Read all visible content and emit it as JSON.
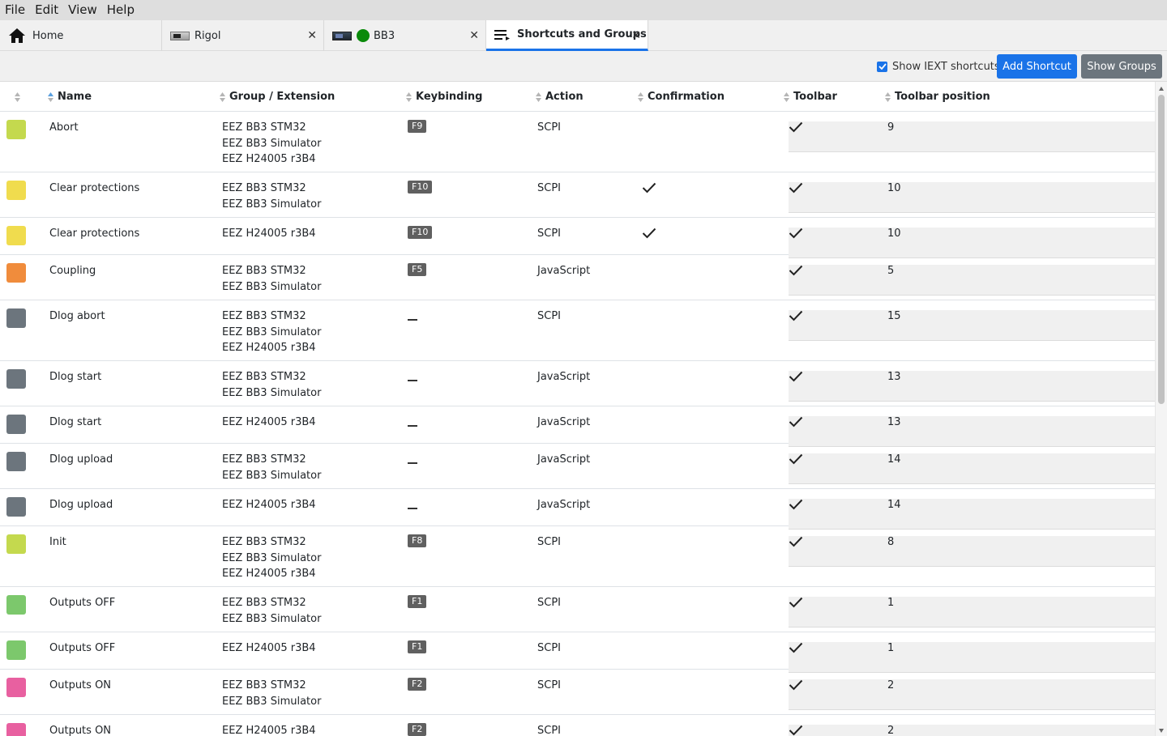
{
  "menu": [
    "File",
    "Edit",
    "View",
    "Help"
  ],
  "tabs": [
    {
      "label": "Home",
      "icon": "home-icon",
      "closable": false,
      "active": false
    },
    {
      "label": "Rigol",
      "icon": "instrument-thumbnail-icon",
      "closable": true,
      "active": false
    },
    {
      "label": "BB3",
      "icon": "instrument-thumbnail-icon",
      "status": "connected",
      "closable": true,
      "active": false
    },
    {
      "label": "Shortcuts and Groups",
      "icon": "playlist-icon",
      "closable": true,
      "active": true
    }
  ],
  "toolbar": {
    "show_iext_label": "Show IEXT shortcuts",
    "show_iext_checked": true,
    "add_shortcut_label": "Add Shortcut",
    "show_groups_label": "Show Groups",
    "accent_color": "#1a73e8",
    "secondary_color": "#6c757d"
  },
  "table": {
    "columns": [
      {
        "key": "color",
        "label": ""
      },
      {
        "key": "name",
        "label": "Name",
        "sorted": "asc"
      },
      {
        "key": "groups",
        "label": "Group / Extension"
      },
      {
        "key": "keybinding",
        "label": "Keybinding"
      },
      {
        "key": "action",
        "label": "Action"
      },
      {
        "key": "confirmation",
        "label": "Confirmation"
      },
      {
        "key": "toolbar",
        "label": "Toolbar"
      },
      {
        "key": "toolbar_position",
        "label": "Toolbar position"
      }
    ],
    "rows": [
      {
        "color": "#c4d94e",
        "name": "Abort",
        "groups": [
          "EEZ BB3 STM32",
          "EEZ BB3 Simulator",
          "EEZ H24005 r3B4"
        ],
        "key": "F9",
        "action": "SCPI",
        "confirmation": false,
        "toolbar": true,
        "position": "9"
      },
      {
        "color": "#f0dc4e",
        "name": "Clear protections",
        "groups": [
          "EEZ BB3 STM32",
          "EEZ BB3 Simulator"
        ],
        "key": "F10",
        "action": "SCPI",
        "confirmation": true,
        "toolbar": true,
        "position": "10"
      },
      {
        "color": "#f0dc4e",
        "name": "Clear protections",
        "groups": [
          "EEZ H24005 r3B4"
        ],
        "key": "F10",
        "action": "SCPI",
        "confirmation": true,
        "toolbar": true,
        "position": "10"
      },
      {
        "color": "#f08c3c",
        "name": "Coupling",
        "groups": [
          "EEZ BB3 STM32",
          "EEZ BB3 Simulator"
        ],
        "key": "F5",
        "action": "JavaScript",
        "confirmation": false,
        "toolbar": true,
        "position": "5"
      },
      {
        "color": "#6c757d",
        "name": "Dlog abort",
        "groups": [
          "EEZ BB3 STM32",
          "EEZ BB3 Simulator",
          "EEZ H24005 r3B4"
        ],
        "key": "",
        "action": "SCPI",
        "confirmation": false,
        "toolbar": true,
        "position": "15"
      },
      {
        "color": "#6c757d",
        "name": "Dlog start",
        "groups": [
          "EEZ BB3 STM32",
          "EEZ BB3 Simulator"
        ],
        "key": "",
        "action": "JavaScript",
        "confirmation": false,
        "toolbar": true,
        "position": "13"
      },
      {
        "color": "#6c757d",
        "name": "Dlog start",
        "groups": [
          "EEZ H24005 r3B4"
        ],
        "key": "",
        "action": "JavaScript",
        "confirmation": false,
        "toolbar": true,
        "position": "13"
      },
      {
        "color": "#6c757d",
        "name": "Dlog upload",
        "groups": [
          "EEZ BB3 STM32",
          "EEZ BB3 Simulator"
        ],
        "key": "",
        "action": "JavaScript",
        "confirmation": false,
        "toolbar": true,
        "position": "14"
      },
      {
        "color": "#6c757d",
        "name": "Dlog upload",
        "groups": [
          "EEZ H24005 r3B4"
        ],
        "key": "",
        "action": "JavaScript",
        "confirmation": false,
        "toolbar": true,
        "position": "14"
      },
      {
        "color": "#c4d94e",
        "name": "Init",
        "groups": [
          "EEZ BB3 STM32",
          "EEZ BB3 Simulator",
          "EEZ H24005 r3B4"
        ],
        "key": "F8",
        "action": "SCPI",
        "confirmation": false,
        "toolbar": true,
        "position": "8"
      },
      {
        "color": "#7cc86c",
        "name": "Outputs OFF",
        "groups": [
          "EEZ BB3 STM32",
          "EEZ BB3 Simulator"
        ],
        "key": "F1",
        "action": "SCPI",
        "confirmation": false,
        "toolbar": true,
        "position": "1"
      },
      {
        "color": "#7cc86c",
        "name": "Outputs OFF",
        "groups": [
          "EEZ H24005 r3B4"
        ],
        "key": "F1",
        "action": "SCPI",
        "confirmation": false,
        "toolbar": true,
        "position": "1"
      },
      {
        "color": "#e860a0",
        "name": "Outputs ON",
        "groups": [
          "EEZ BB3 STM32",
          "EEZ BB3 Simulator"
        ],
        "key": "F2",
        "action": "SCPI",
        "confirmation": false,
        "toolbar": true,
        "position": "2"
      },
      {
        "color": "#e860a0",
        "name": "Outputs ON",
        "groups": [
          "EEZ H24005 r3B4"
        ],
        "key": "F2",
        "action": "SCPI",
        "confirmation": false,
        "toolbar": true,
        "position": "2"
      }
    ]
  }
}
